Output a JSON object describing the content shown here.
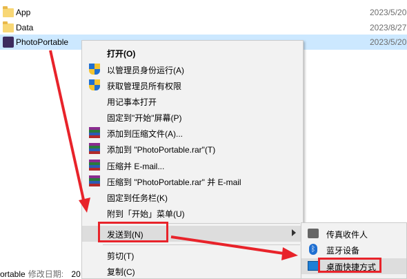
{
  "files": [
    {
      "name": "App",
      "date": "2023/5/20",
      "icon": "folder-icon",
      "selected": false
    },
    {
      "name": "Data",
      "date": "2023/8/27",
      "icon": "folder-icon",
      "selected": false
    },
    {
      "name": "PhotoPortable",
      "date": "2023/5/20",
      "icon": "app-icon",
      "selected": true
    }
  ],
  "status": {
    "name": "ortable",
    "label": "修改日期:",
    "value": "20"
  },
  "context_menu": {
    "items": [
      {
        "label": "打开(O)",
        "icon": "",
        "bold": true
      },
      {
        "label": "以管理员身份运行(A)",
        "icon": "uac-shield-icon"
      },
      {
        "label": "获取管理员所有权限",
        "icon": "uac-shield-icon"
      },
      {
        "label": "用记事本打开",
        "icon": ""
      },
      {
        "label": "固定到\"开始\"屏幕(P)",
        "icon": ""
      },
      {
        "label": "添加到压缩文件(A)...",
        "icon": "winrar-icon"
      },
      {
        "label": "添加到 \"PhotoPortable.rar\"(T)",
        "icon": "winrar-icon"
      },
      {
        "label": "压缩并 E-mail...",
        "icon": "winrar-icon"
      },
      {
        "label": "压缩到 \"PhotoPortable.rar\" 并 E-mail",
        "icon": "winrar-icon"
      },
      {
        "label": "固定到任务栏(K)",
        "icon": ""
      },
      {
        "label": "附到「开始」菜单(U)",
        "icon": ""
      },
      {
        "label": "发送到(N)",
        "icon": "",
        "submenu": true
      },
      {
        "label": "剪切(T)",
        "icon": ""
      },
      {
        "label": "复制(C)",
        "icon": ""
      }
    ]
  },
  "send_to_submenu": {
    "items": [
      {
        "label": "传真收件人",
        "icon": "fax-icon"
      },
      {
        "label": "蓝牙设备",
        "icon": "bluetooth-icon"
      },
      {
        "label": "桌面快捷方式",
        "icon": "desktop-icon"
      }
    ]
  },
  "colors": {
    "selection": "#cce8ff",
    "highlight": "#e8232a",
    "menu_bg": "#f2f2f2"
  }
}
